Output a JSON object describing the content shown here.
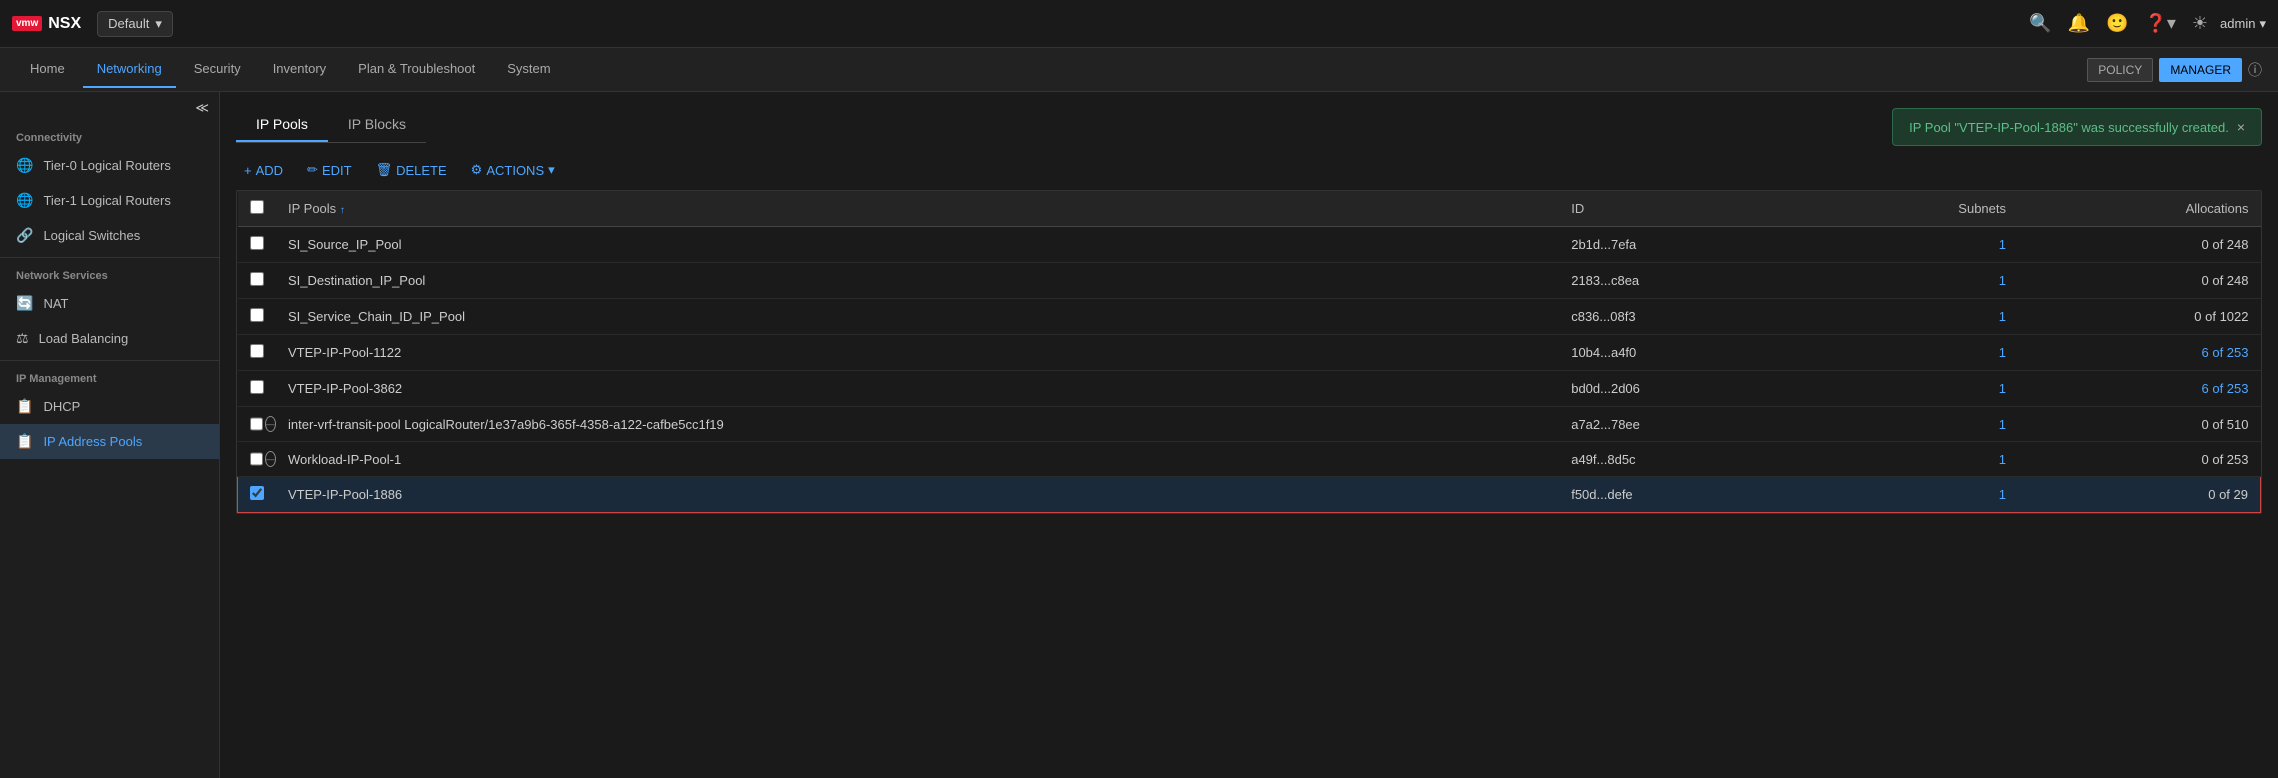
{
  "app": {
    "logo": "vmw",
    "name": "NSX"
  },
  "env_selector": {
    "label": "Default",
    "chevron": "▾"
  },
  "topbar_icons": [
    "🔍",
    "🔔",
    "😊",
    "❓",
    "☀"
  ],
  "topbar_user": {
    "name": "admin",
    "chevron": "▾"
  },
  "navbar": {
    "items": [
      {
        "label": "Home",
        "active": false
      },
      {
        "label": "Networking",
        "active": true
      },
      {
        "label": "Security",
        "active": false
      },
      {
        "label": "Inventory",
        "active": false
      },
      {
        "label": "Plan & Troubleshoot",
        "active": false
      },
      {
        "label": "System",
        "active": false
      }
    ],
    "policy_btn": "POLICY",
    "manager_btn": "MANAGER",
    "info_icon": "ⓘ"
  },
  "sidebar": {
    "collapse_icon": "≪",
    "sections": [
      {
        "label": "Connectivity",
        "items": [
          {
            "label": "Tier-0 Logical Routers",
            "icon": "🌐",
            "active": false
          },
          {
            "label": "Tier-1 Logical Routers",
            "icon": "🌐",
            "active": false
          },
          {
            "label": "Logical Switches",
            "icon": "🔗",
            "active": false
          }
        ]
      },
      {
        "label": "Network Services",
        "items": [
          {
            "label": "NAT",
            "icon": "🔄",
            "active": false
          },
          {
            "label": "Load Balancing",
            "icon": "⚖",
            "active": false
          }
        ]
      },
      {
        "label": "IP Management",
        "items": [
          {
            "label": "DHCP",
            "icon": "📋",
            "active": false
          },
          {
            "label": "IP Address Pools",
            "icon": "📋",
            "active": true
          }
        ]
      }
    ]
  },
  "tabs": [
    {
      "label": "IP Pools",
      "active": true
    },
    {
      "label": "IP Blocks",
      "active": false
    }
  ],
  "toast": {
    "message": "IP Pool \"VTEP-IP-Pool-1886\" was successfully created.",
    "close": "×"
  },
  "toolbar": {
    "add": "+ ADD",
    "edit": "✏ EDIT",
    "delete": "🗑 DELETE",
    "actions": "⚙ ACTIONS ▾"
  },
  "table": {
    "columns": [
      "IP Pools",
      "ID",
      "Subnets",
      "Allocations"
    ],
    "rows": [
      {
        "name": "SI_Source_IP_Pool",
        "id": "2b1d...7efa",
        "subnets": "1",
        "allocations": "0 of 248",
        "selected": false,
        "has_circle": false
      },
      {
        "name": "SI_Destination_IP_Pool",
        "id": "2183...c8ea",
        "subnets": "1",
        "allocations": "0 of 248",
        "selected": false,
        "has_circle": false
      },
      {
        "name": "SI_Service_Chain_ID_IP_Pool",
        "id": "c836...08f3",
        "subnets": "1",
        "allocations": "0 of 1022",
        "selected": false,
        "has_circle": false
      },
      {
        "name": "VTEP-IP-Pool-1122",
        "id": "10b4...a4f0",
        "subnets": "1",
        "allocations": "6 of 253",
        "selected": false,
        "has_circle": false
      },
      {
        "name": "VTEP-IP-Pool-3862",
        "id": "bd0d...2d06",
        "subnets": "1",
        "allocations": "6 of 253",
        "selected": false,
        "has_circle": false
      },
      {
        "name": "inter-vrf-transit-pool LogicalRouter/1e37a9b6-365f-4358-a122-cafbe5cc1f19",
        "id": "a7a2...78ee",
        "subnets": "1",
        "allocations": "0 of 510",
        "selected": false,
        "has_circle": true
      },
      {
        "name": "Workload-IP-Pool-1",
        "id": "a49f...8d5c",
        "subnets": "1",
        "allocations": "0 of 253",
        "selected": false,
        "has_circle": true
      },
      {
        "name": "VTEP-IP-Pool-1886",
        "id": "f50d...defe",
        "subnets": "1",
        "allocations": "0 of 29",
        "selected": true,
        "has_circle": false
      }
    ]
  }
}
